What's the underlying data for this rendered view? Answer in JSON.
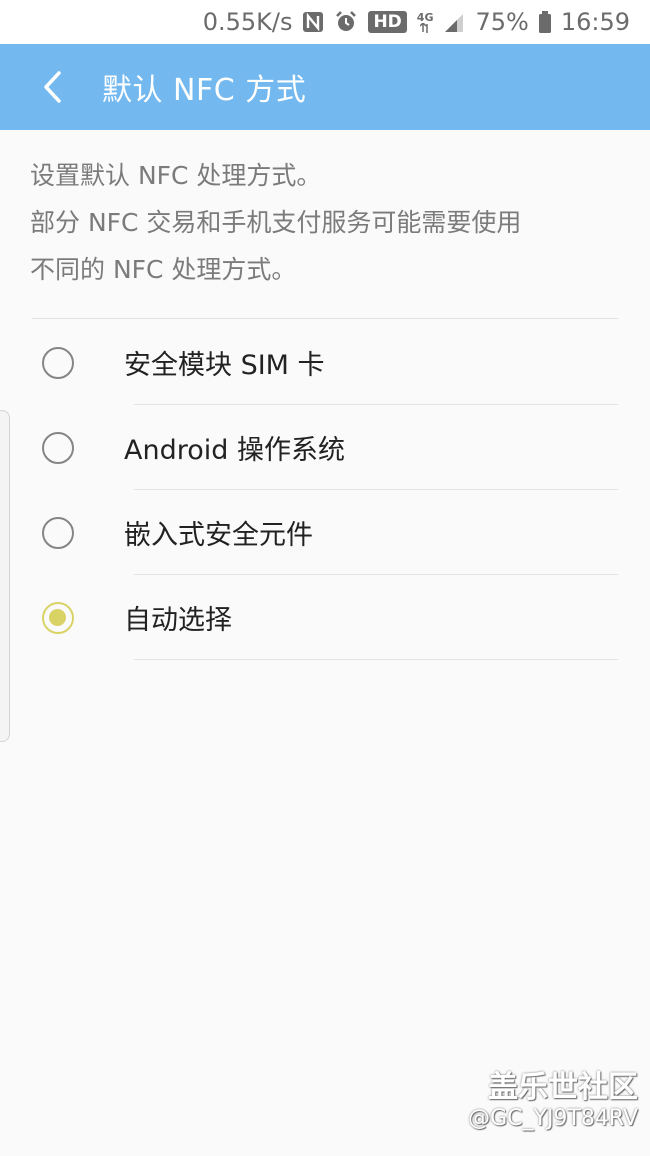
{
  "status_bar": {
    "speed": "0.55K/s",
    "nfc_icon": "nfc-icon",
    "alarm_icon": "alarm-icon",
    "hd_label": "HD",
    "network_label": "4G",
    "battery_percent": "75%",
    "time": "16:59"
  },
  "header": {
    "back_icon": "back-arrow-icon",
    "title": "默认 NFC 方式",
    "background": "#73b8ee"
  },
  "description": {
    "line1": "设置默认 NFC 处理方式。",
    "line2": "部分 NFC 交易和手机支付服务可能需要使用",
    "line3": "不同的 NFC 处理方式。"
  },
  "options": [
    {
      "label": "安全模块 SIM 卡",
      "checked": false
    },
    {
      "label": "Android 操作系统",
      "checked": false
    },
    {
      "label": "嵌入式安全元件",
      "checked": false
    },
    {
      "label": "自动选择",
      "checked": true
    }
  ],
  "accent_color": "#d9d366",
  "watermark": {
    "brand": "盖乐世社区",
    "user": "@GC_YJ9T84RV"
  }
}
